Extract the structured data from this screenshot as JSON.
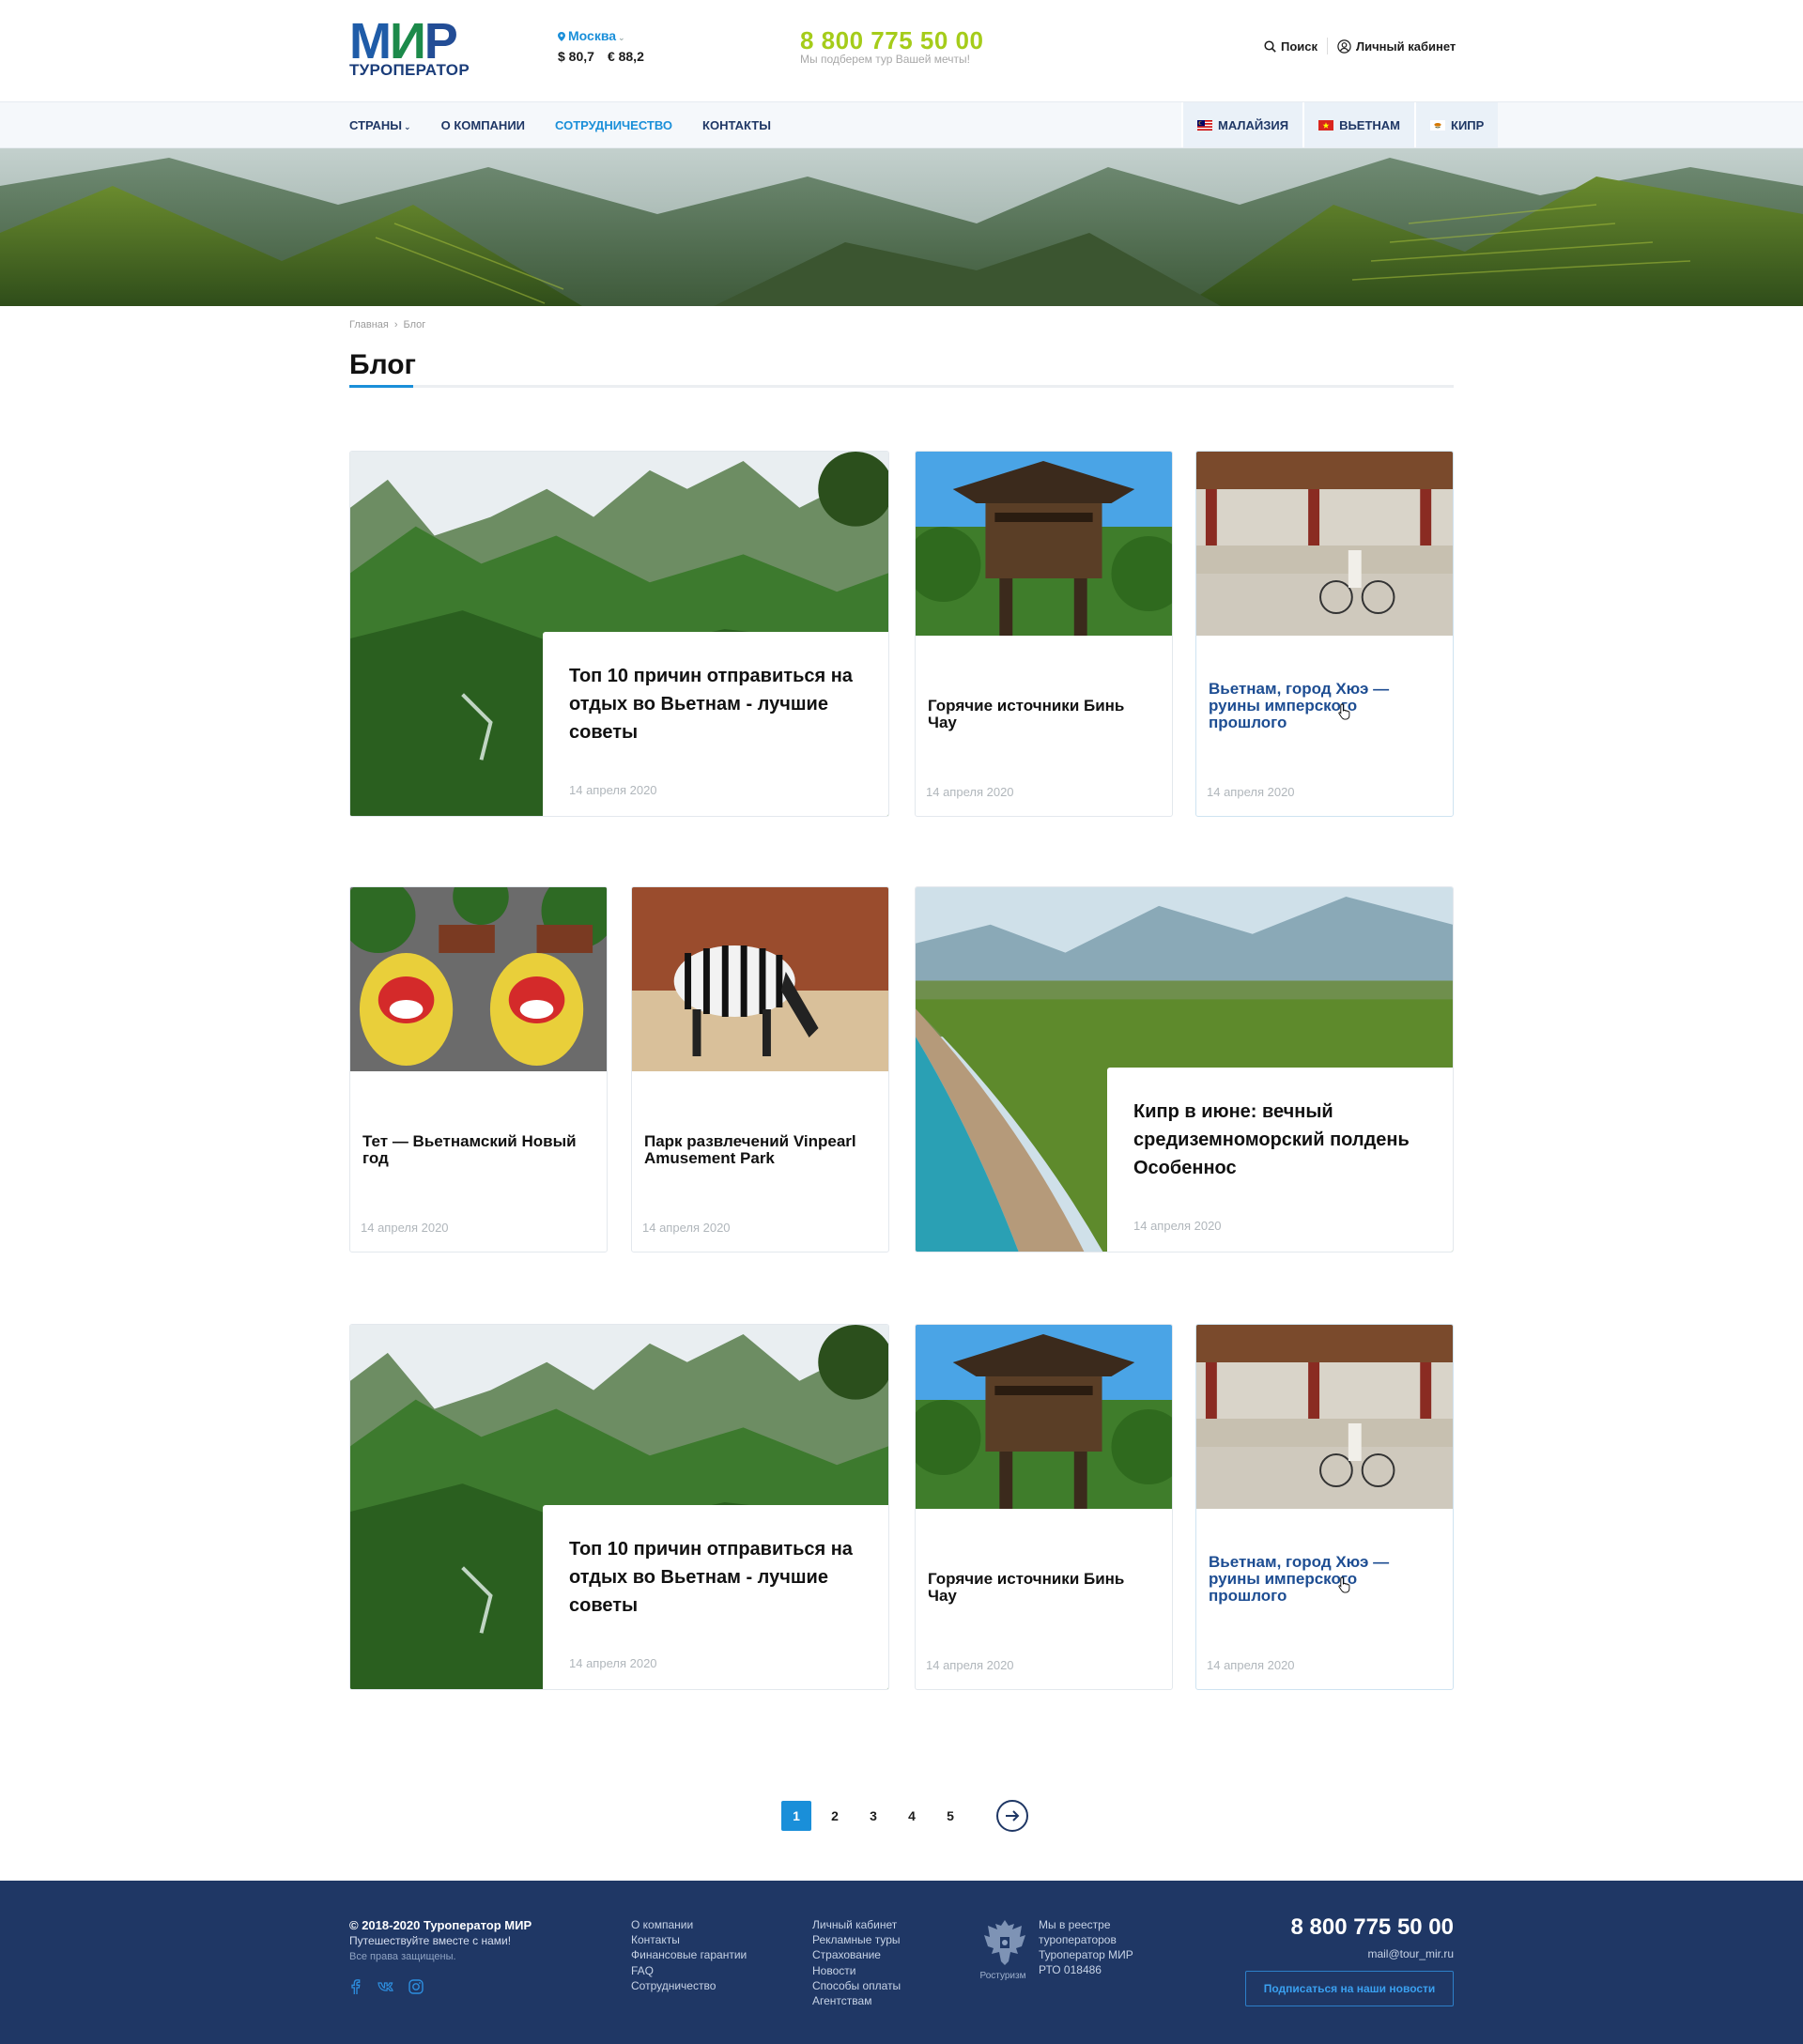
{
  "header": {
    "logo_main": "МИР",
    "logo_sub": "ТУРОПЕРАТОР",
    "city": "Москва",
    "rate_usd": "$ 80,7",
    "rate_eur": "€ 88,2",
    "phone": "8 800 775 50 00",
    "phone_caption": "Мы подберем тур Вашей мечты!",
    "search_label": "Поиск",
    "account_label": "Личный кабинет"
  },
  "nav": {
    "items": [
      "СТРАНЫ",
      "О КОМПАНИИ",
      "СОТРУДНИЧЕСТВО",
      "КОНТАКТЫ"
    ],
    "countries": [
      "МАЛАЙЗИЯ",
      "ВЬЕТНАМ",
      "КИПР"
    ]
  },
  "breadcrumb": [
    "Главная",
    "Блог"
  ],
  "page_title": "Блог",
  "cards": [
    {
      "title": "Топ 10 причин отправиться на отдых во Вьетнам - лучшие советы",
      "date": "14 апреля 2020"
    },
    {
      "title": "Горячие источники Бинь Чау",
      "date": "14 апреля 2020"
    },
    {
      "title": "Вьетнам, город Хюэ — руины имперского прошлого",
      "date": "14 апреля 2020"
    },
    {
      "title": "Тет — Вьетнамский Новый год",
      "date": "14 апреля 2020"
    },
    {
      "title": "Парк развлечений Vinpearl Amusement Park",
      "date": "14 апреля 2020"
    },
    {
      "title": "Кипр в июне: вечный средиземноморский полдень Особеннос",
      "date": "14 апреля 2020"
    },
    {
      "title": "Топ 10 причин отправиться на отдых во Вьетнам - лучшие советы",
      "date": "14 апреля 2020"
    },
    {
      "title": "Горячие источники Бинь Чау",
      "date": "14 апреля 2020"
    },
    {
      "title": "Вьетнам, город Хюэ — руины имперского прошлого",
      "date": "14 апреля 2020"
    }
  ],
  "pagination": {
    "pages": [
      "1",
      "2",
      "3",
      "4",
      "5"
    ],
    "current": "1"
  },
  "footer": {
    "copyright": "© 2018-2020 Туроператор МИР",
    "slogan": "Путешествуйте вместе с нами!",
    "rights": "Все права защищены.",
    "col1": [
      "О компании",
      "Контакты",
      "Финансовые гарантии",
      "FAQ",
      "Сотрудничество"
    ],
    "col2": [
      "Личный кабинет",
      "Рекламные туры",
      "Страхование",
      "Новости",
      "Способы оплаты",
      "Агентствам"
    ],
    "emblem_caption": "Ростуризм",
    "registry": [
      "Мы в реестре",
      "туроператоров",
      "Туроператор МИР",
      "РТО 018486"
    ],
    "phone": "8 800 775 50 00",
    "email": "mail@tour_mir.ru",
    "subscribe": "Подписаться на наши новости"
  },
  "colors": {
    "accent_blue": "#1a8fd9",
    "navy": "#1f3765",
    "phone_green": "#a5cc1a",
    "highlight_title": "#1d4d92"
  }
}
